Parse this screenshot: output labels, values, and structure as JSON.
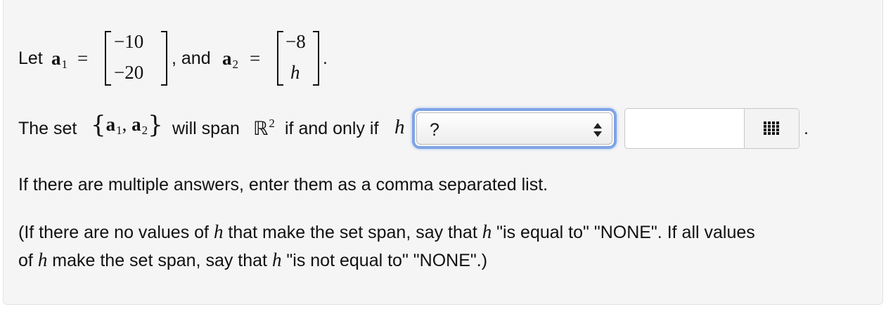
{
  "problem": {
    "let_label": "Let",
    "vec1_name": "a",
    "vec1_sub": "1",
    "equals": "=",
    "vec1_entries": [
      "−10",
      "−20"
    ],
    "comma_and": ", and",
    "vec2_name": "a",
    "vec2_sub": "2",
    "vec2_entries": [
      "−8",
      "h"
    ],
    "period": "."
  },
  "span_line": {
    "prefix": "The set",
    "set_open": "{",
    "set_a1": "a",
    "set_a1_sub": "1",
    "set_comma": ",",
    "set_a2": "a",
    "set_a2_sub": "2",
    "set_close": "}",
    "will_span": "will span",
    "space_symbol": "ℝ",
    "space_exp": "2",
    "condition": "if and only if",
    "var": "h",
    "select_value": "?",
    "answer_value": "",
    "trailing_period": "."
  },
  "instructions": {
    "line1": "If there are multiple answers, enter them as a comma separated list.",
    "line2_part1": "(If there are no values of",
    "line2_var": "h",
    "line2_part2": "that make the set span, say that",
    "line2_var2": "h",
    "line2_part3": "\"is equal to\" \"NONE\". If all values",
    "line3_part1": "of",
    "line3_var": "h",
    "line3_part2": "make the set span, say that",
    "line3_var2": "h",
    "line3_part3": "\"is not equal to\" \"NONE\".)"
  },
  "icons": {
    "select_arrows": "up-down-arrows-icon",
    "keypad": "grid-keypad-icon"
  },
  "colors": {
    "focus_border": "#7ea4e6",
    "panel_bg": "#f5f5f5"
  }
}
